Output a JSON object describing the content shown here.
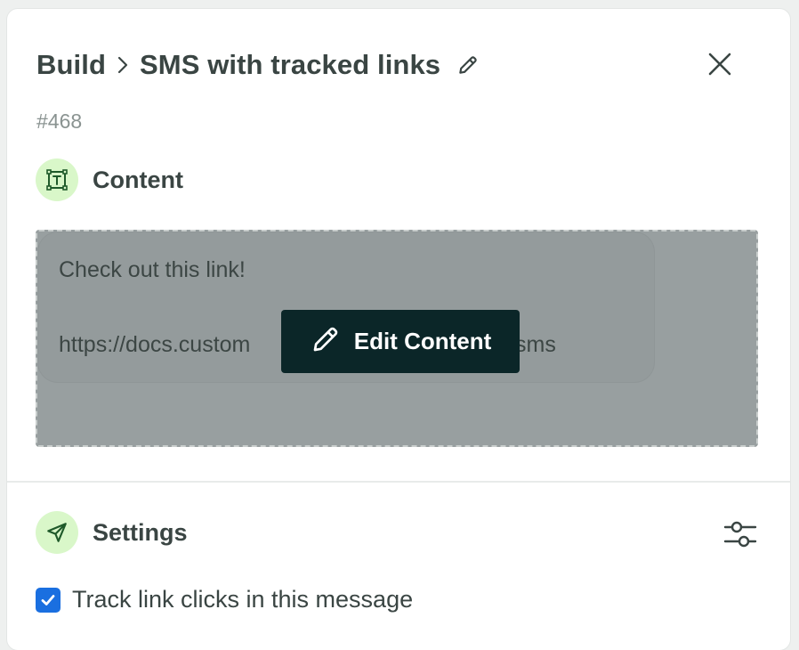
{
  "breadcrumb": {
    "parent": "Build",
    "current": "SMS with tracked links"
  },
  "message_id": "#468",
  "content_section": {
    "title": "Content",
    "sms_line1": "Check out this link!",
    "sms_line2_visible": "https://docs.custom",
    "sms_line2_tail": "sms",
    "edit_button_label": "Edit Content"
  },
  "settings_section": {
    "title": "Settings",
    "track_clicks": {
      "label": "Track link clicks in this message",
      "checked": true
    }
  },
  "colors": {
    "accent_icon_bg": "#d9f7c9",
    "dark_button": "#0b2628",
    "checkbox_blue": "#1a6fe0",
    "overlay_gray": "#989fa0"
  },
  "icons": {
    "title_edit": "pencil-icon",
    "close": "close-icon",
    "content": "text-frame-icon",
    "edit_content": "pencil-icon",
    "settings": "send-icon",
    "settings_adjust": "sliders-icon",
    "checkbox": "check-icon"
  }
}
